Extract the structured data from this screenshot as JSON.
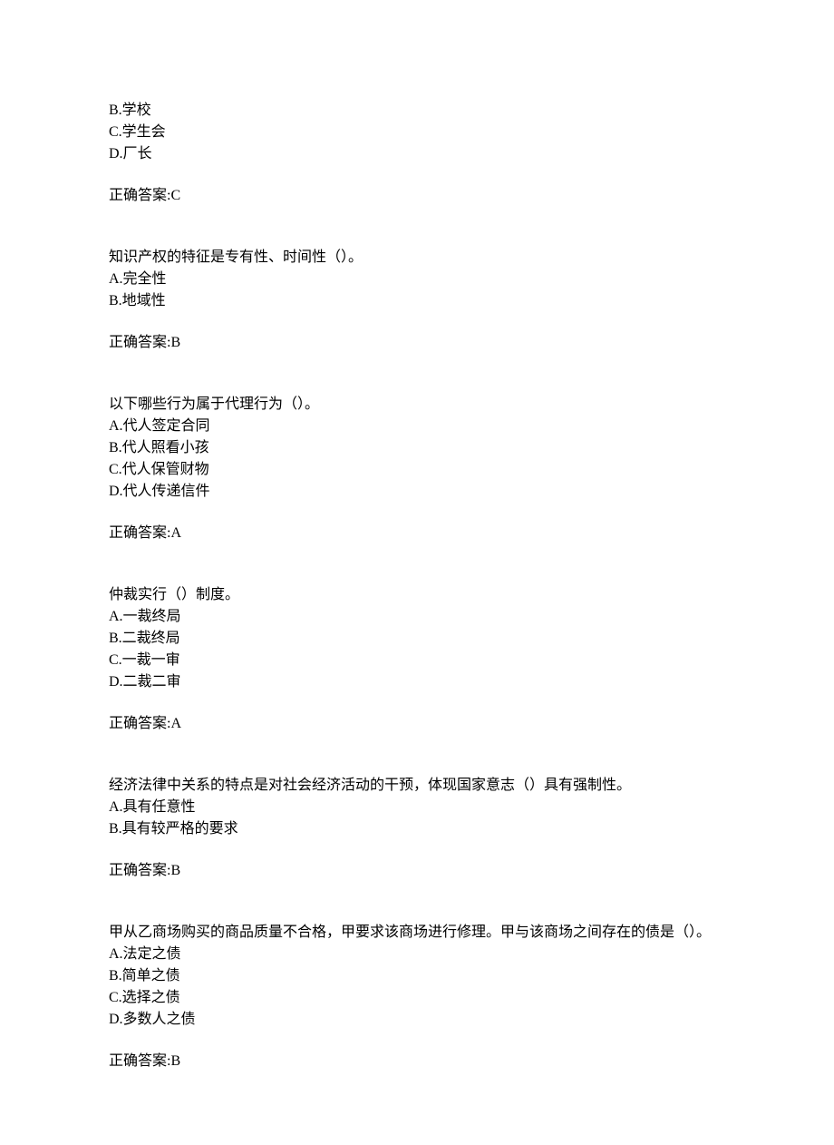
{
  "q0": {
    "options": {
      "b": "B.学校",
      "c": "C.学生会",
      "d": "D.厂长"
    },
    "answer": "正确答案:C"
  },
  "q1": {
    "stem": "知识产权的特征是专有性、时间性（）。",
    "options": {
      "a": "A.完全性",
      "b": "B.地域性"
    },
    "answer": "正确答案:B"
  },
  "q2": {
    "stem": "以下哪些行为属于代理行为（）。",
    "options": {
      "a": "A.代人签定合同",
      "b": "B.代人照看小孩",
      "c": "C.代人保管财物",
      "d": "D.代人传递信件"
    },
    "answer": "正确答案:A"
  },
  "q3": {
    "stem": "仲裁实行（）制度。",
    "options": {
      "a": "A.一裁终局",
      "b": "B.二裁终局",
      "c": "C.一裁一审",
      "d": "D.二裁二审"
    },
    "answer": "正确答案:A"
  },
  "q4": {
    "stem": "经济法律中关系的特点是对社会经济活动的干预，体现国家意志（）具有强制性。",
    "options": {
      "a": "A.具有任意性",
      "b": "B.具有较严格的要求"
    },
    "answer": "正确答案:B"
  },
  "q5": {
    "stem": "甲从乙商场购买的商品质量不合格，甲要求该商场进行修理。甲与该商场之间存在的债是（）。",
    "options": {
      "a": "A.法定之债",
      "b": "B.简单之债",
      "c": "C.选择之债",
      "d": "D.多数人之债"
    },
    "answer": "正确答案:B"
  }
}
